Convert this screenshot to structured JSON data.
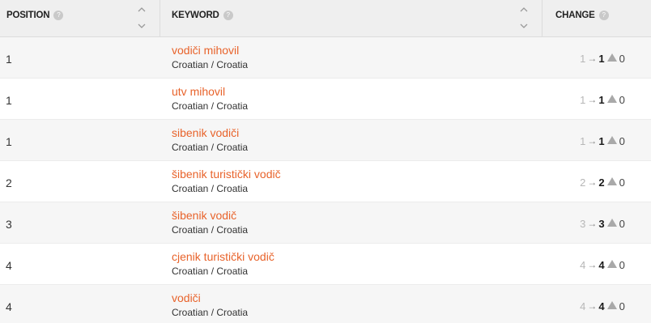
{
  "header": {
    "position_label": "POSITION",
    "keyword_label": "KEYWORD",
    "change_label": "CHANGE",
    "info_glyph": "?"
  },
  "colors": {
    "accent": "#e8632b",
    "header_bg": "#efefef",
    "row_alt": "#f6f6f6"
  },
  "rows": [
    {
      "position": "1",
      "keyword": "vodiči mihovil",
      "language": "Croatian / Croatia",
      "prev": "1",
      "arrow": "→",
      "current": "1",
      "delta": "0"
    },
    {
      "position": "1",
      "keyword": "utv mihovil",
      "language": "Croatian / Croatia",
      "prev": "1",
      "arrow": "→",
      "current": "1",
      "delta": "0"
    },
    {
      "position": "1",
      "keyword": "sibenik vodiči",
      "language": "Croatian / Croatia",
      "prev": "1",
      "arrow": "→",
      "current": "1",
      "delta": "0"
    },
    {
      "position": "2",
      "keyword": "šibenik turistički vodič",
      "language": "Croatian / Croatia",
      "prev": "2",
      "arrow": "→",
      "current": "2",
      "delta": "0"
    },
    {
      "position": "3",
      "keyword": "šibenik vodič",
      "language": "Croatian / Croatia",
      "prev": "3",
      "arrow": "→",
      "current": "3",
      "delta": "0"
    },
    {
      "position": "4",
      "keyword": "cjenik turistički vodič",
      "language": "Croatian / Croatia",
      "prev": "4",
      "arrow": "→",
      "current": "4",
      "delta": "0"
    },
    {
      "position": "4",
      "keyword": "vodiči",
      "language": "Croatian / Croatia",
      "prev": "4",
      "arrow": "→",
      "current": "4",
      "delta": "0"
    }
  ]
}
